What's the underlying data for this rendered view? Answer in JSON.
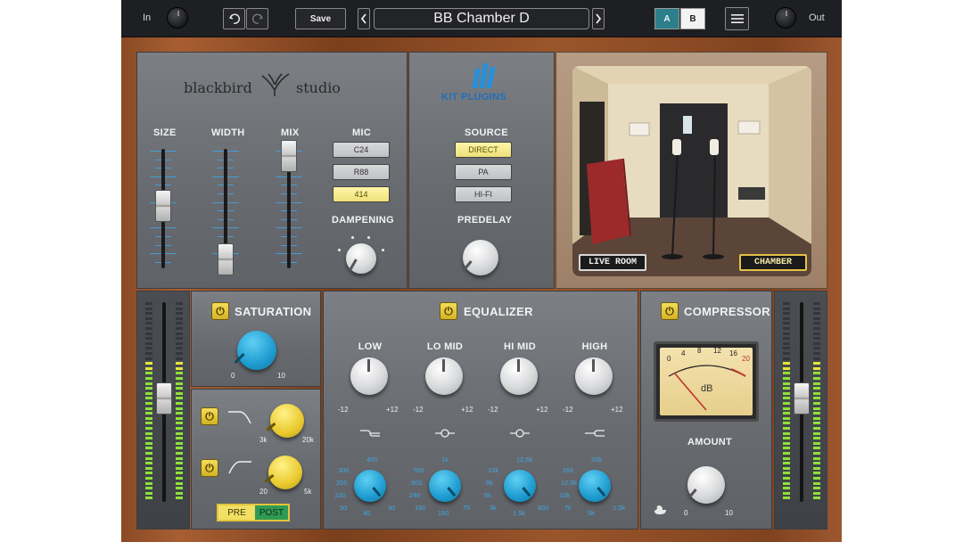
{
  "topbar": {
    "in_label": "In",
    "out_label": "Out",
    "undo_icon": "undo-icon",
    "redo_icon": "redo-icon",
    "save_label": "Save",
    "prev_icon": "chevron-left-icon",
    "next_icon": "chevron-right-icon",
    "preset_name": "BB Chamber D",
    "a_label": "A",
    "b_label": "B",
    "menu_icon": "hamburger-menu-icon",
    "active_slot": "A",
    "colors": {
      "a_active": "#2c7f8a"
    }
  },
  "header": {
    "brand_left": "blackbird",
    "brand_right": "studio",
    "kit_logo": "KIT PLUGINS"
  },
  "room": {
    "size_label": "SIZE",
    "width_label": "WIDTH",
    "mix_label": "MIX",
    "mic_label": "MIC",
    "mic_options": [
      "C24",
      "R88",
      "414"
    ],
    "mic_selected": "414",
    "dampening_label": "DAMPENING",
    "source_label": "SOURCE",
    "source_options": [
      "DIRECT",
      "PA",
      "HI-FI"
    ],
    "source_selected": "DIRECT",
    "predelay_label": "PREDELAY"
  },
  "photo": {
    "live_room": "LIVE ROOM",
    "chamber": "CHAMBER"
  },
  "saturation": {
    "title": "SATURATION",
    "min": "0",
    "max": "10"
  },
  "filters": {
    "hp_min": "3k",
    "hp_max": "20k",
    "lp_min": "20",
    "lp_max": "5k",
    "pre_label": "PRE",
    "post_label": "POST"
  },
  "eq": {
    "title": "EQUALIZER",
    "bands": [
      {
        "label": "LOW",
        "min": "-12",
        "max": "+12",
        "freqs": [
          "400",
          "300",
          "200",
          "100",
          "50",
          "40",
          "30"
        ]
      },
      {
        "label": "LO MID",
        "min": "-12",
        "max": "+12",
        "freqs": [
          "1k",
          "700",
          "500",
          "240",
          "180",
          "150",
          "75"
        ]
      },
      {
        "label": "HI MID",
        "min": "-12",
        "max": "+12",
        "freqs": [
          "12,5k",
          "10k",
          "8k",
          "5k",
          "3k",
          "1.5k",
          "800"
        ]
      },
      {
        "label": "HIGH",
        "min": "-12",
        "max": "+12",
        "freqs": [
          "20k",
          "15k",
          "12.5k",
          "10k",
          "7k",
          "5k",
          "2.5k"
        ]
      }
    ]
  },
  "compressor": {
    "title": "COMPRESSOR",
    "vu_scale": [
      "0",
      "4",
      "8",
      "12",
      "16",
      "20"
    ],
    "vu_unit": "dB",
    "amount_label": "AMOUNT",
    "min": "0",
    "max": "10"
  }
}
